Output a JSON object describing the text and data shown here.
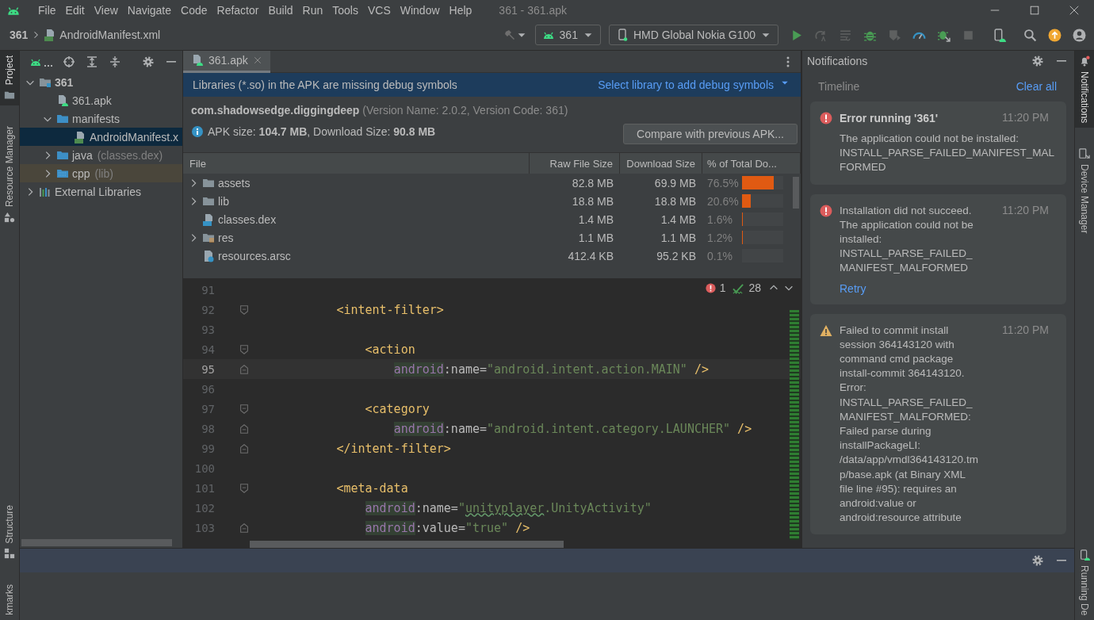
{
  "window": {
    "title": "361 - 361.apk",
    "menu": [
      "File",
      "Edit",
      "View",
      "Navigate",
      "Code",
      "Refactor",
      "Build",
      "Run",
      "Tools",
      "VCS",
      "Window",
      "Help"
    ]
  },
  "breadcrumb": [
    "361",
    "AndroidManifest.xml"
  ],
  "toolbar": {
    "run_config": "361",
    "device": "HMD Global Nokia G100"
  },
  "left_stripe": {
    "top": [
      {
        "label": "Project",
        "selected": true,
        "kind": "folder"
      },
      {
        "label": "Resource Manager",
        "selected": false,
        "kind": "shapes"
      }
    ],
    "bottom": [
      {
        "label": "Structure",
        "selected": false,
        "kind": "structure"
      },
      {
        "label": "kmarks",
        "selected": false
      }
    ]
  },
  "project": {
    "tree": [
      {
        "label": "361",
        "kind": "module",
        "expanded": true,
        "selected": false,
        "children": [
          {
            "label": "361.apk",
            "kind": "apk",
            "selected": false
          },
          {
            "label": "manifests",
            "kind": "folder",
            "expanded": true,
            "selected": false,
            "children": [
              {
                "label": "AndroidManifest.x",
                "kind": "manifest",
                "selected": true
              }
            ]
          },
          {
            "label": "java",
            "hint": "(classes.dex)",
            "kind": "folder",
            "expanded": false,
            "selected": false
          },
          {
            "label": "cpp",
            "hint": "(lib)",
            "kind": "native",
            "expanded": false,
            "selected": false,
            "highlighted": true
          }
        ]
      },
      {
        "label": "External Libraries",
        "kind": "libraries",
        "expanded": false,
        "selected": false
      }
    ]
  },
  "editor": {
    "tabs": [
      {
        "label": "361.apk",
        "selected": true
      }
    ],
    "banner": {
      "message": "Libraries (*.so) in the APK are missing debug symbols",
      "action": "Select library to add debug symbols"
    },
    "package": "**com.shadowsedge.diggingdeep** (Version Name: 2.0.2, Version Code: 361)",
    "size_info": "APK size: **104.7 MB**, Download Size: **90.8 MB**",
    "compare_button": "Compare with previous APK...",
    "table": {
      "columns": [
        "File",
        "Raw File Size",
        "Download Size",
        "% of Total Do..."
      ],
      "rows": [
        {
          "name": "assets",
          "kind": "folder",
          "expanded": false,
          "raw": "82.8 MB",
          "download": "69.9 MB",
          "percent": "76.5%",
          "level": 0.765
        },
        {
          "name": "lib",
          "kind": "folder",
          "expanded": false,
          "raw": "18.8 MB",
          "download": "18.8 MB",
          "percent": "20.6%",
          "level": 0.206
        },
        {
          "name": "classes.dex",
          "kind": "dex",
          "raw": "1.4 MB",
          "download": "1.4 MB",
          "percent": "1.6%",
          "level": 0.016
        },
        {
          "name": "res",
          "kind": "res",
          "expanded": false,
          "raw": "1.1 MB",
          "download": "1.1 MB",
          "percent": "1.2%",
          "level": 0.012
        },
        {
          "name": "resources.arsc",
          "kind": "arsc",
          "raw": "412.4 KB",
          "download": "95.2 KB",
          "percent": "0.1%",
          "level": 0.001
        }
      ]
    },
    "code": {
      "inspections": {
        "errors": "1",
        "warnings": "28"
      },
      "lines": [
        {
          "number": "91",
          "current": false,
          "fold_start": false,
          "fold_end": false
        },
        {
          "number": "92",
          "current": false,
          "fold_start": true,
          "fold_end": false,
          "tokens": [
            {
              "kind": "tag",
              "t": "            <intent-filter>"
            }
          ]
        },
        {
          "number": "93",
          "current": false,
          "fold_start": false,
          "fold_end": false
        },
        {
          "number": "94",
          "current": false,
          "fold_start": true,
          "fold_end": false,
          "tokens": [
            {
              "kind": "tag",
              "t": "                <action"
            }
          ]
        },
        {
          "number": "95",
          "current": true,
          "fold_start": false,
          "fold_end": true,
          "tokens": [
            {
              "kind": "ns",
              "t": "                    android"
            },
            {
              "kind": "attr",
              "t": ":name="
            },
            {
              "kind": "value",
              "t": "\"android.intent.action.MAIN\""
            },
            {
              "kind": "tag",
              "t": " />"
            }
          ]
        },
        {
          "number": "96",
          "current": false,
          "fold_start": false,
          "fold_end": false
        },
        {
          "number": "97",
          "current": false,
          "fold_start": true,
          "fold_end": false,
          "tokens": [
            {
              "kind": "tag",
              "t": "                <category"
            }
          ]
        },
        {
          "number": "98",
          "current": false,
          "fold_start": false,
          "fold_end": true,
          "tokens": [
            {
              "kind": "ns",
              "t": "                    android"
            },
            {
              "kind": "attr",
              "t": ":name="
            },
            {
              "kind": "value",
              "t": "\"android.intent.category.LAUNCHER\""
            },
            {
              "kind": "tag",
              "t": " />"
            }
          ]
        },
        {
          "number": "99",
          "current": false,
          "fold_start": false,
          "fold_end": true,
          "tokens": [
            {
              "kind": "tag",
              "t": "            </intent-filter>"
            }
          ]
        },
        {
          "number": "100",
          "current": false,
          "fold_start": false,
          "fold_end": false
        },
        {
          "number": "101",
          "current": false,
          "fold_start": true,
          "fold_end": false,
          "tokens": [
            {
              "kind": "tag",
              "t": "            <meta-data"
            }
          ]
        },
        {
          "number": "102",
          "current": false,
          "fold_start": false,
          "fold_end": false,
          "tokens": [
            {
              "kind": "ns",
              "t": "                android"
            },
            {
              "kind": "attr",
              "t": ":name="
            },
            {
              "kind": "value",
              "t": "\""
            },
            {
              "kind": "typo",
              "t": "unityplayer"
            },
            {
              "kind": "value",
              "t": ".UnityActivity\""
            }
          ]
        },
        {
          "number": "103",
          "current": false,
          "fold_start": false,
          "fold_end": true,
          "tokens": [
            {
              "kind": "ns",
              "t": "                android"
            },
            {
              "kind": "attr",
              "t": ":value="
            },
            {
              "kind": "value",
              "t": "\"true\""
            },
            {
              "kind": "tag",
              "t": " />"
            }
          ]
        }
      ]
    }
  },
  "notifications": {
    "title": "Notifications",
    "timeline": "Timeline",
    "clear": "Clear all",
    "items": [
      {
        "kind": "error",
        "title": "Error running '361'",
        "time": "11:20 PM",
        "body": "The application could not be installed: INSTALL_PARSE_FAILED_MANIFEST_MALFORMED"
      },
      {
        "kind": "error",
        "message": "Installation did not succeed.\nThe application could not be installed:\nINSTALL_PARSE_FAILED_MANIFEST_MALFORMED",
        "time": "11:20 PM",
        "action": "Retry"
      },
      {
        "kind": "warning",
        "message": "Failed to commit install session 364143120 with command cmd package install-commit 364143120.\nError:\nINSTALL_PARSE_FAILED_MANIFEST_MALFORMED: Failed parse during installPackageLI: /data/app/vmdl364143120.tmp/base.apk (at Binary XML file line #95):  requires an android:value or android:resource attribute",
        "time": "11:20 PM"
      }
    ]
  },
  "right_stripe": {
    "top": [
      {
        "label": "Notifications",
        "selected": true,
        "kind": "bell"
      },
      {
        "label": "Device Manager",
        "selected": false,
        "kind": "device"
      }
    ],
    "bottom": [
      {
        "label": "Running De",
        "selected": false,
        "kind": "mirror"
      }
    ]
  }
}
